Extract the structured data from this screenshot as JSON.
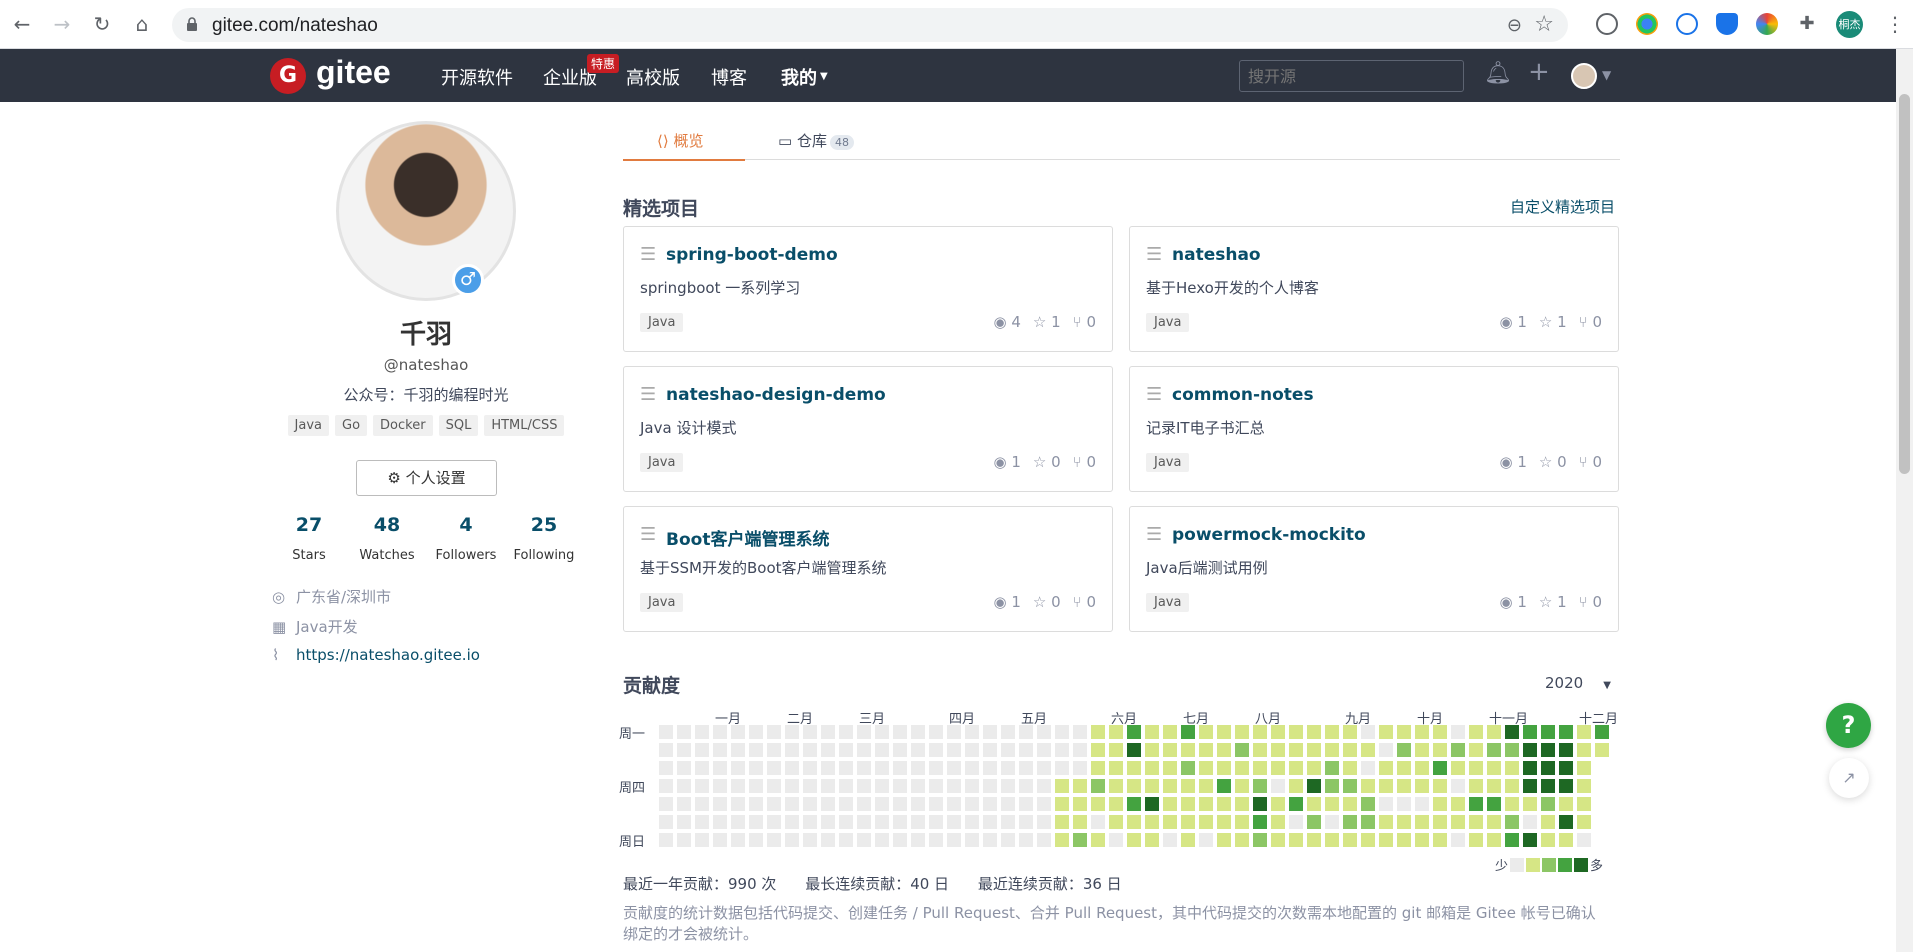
{
  "browser": {
    "url": "gitee.com/nateshao",
    "profile_badge": "桐杰"
  },
  "topnav": {
    "logo": "gitee",
    "links": [
      "开源软件",
      "企业版",
      "高校版",
      "博客",
      "我的"
    ],
    "hot_badge": "特惠",
    "search_placeholder": "搜开源"
  },
  "profile": {
    "name": "千羽",
    "handle": "@nateshao",
    "bio": "公众号：千羽的编程时光",
    "skills": [
      "Java",
      "Go",
      "Docker",
      "SQL",
      "HTML/CSS"
    ],
    "settings_label": "个人设置",
    "stats": [
      {
        "num": "27",
        "label": "Stars"
      },
      {
        "num": "48",
        "label": "Watches"
      },
      {
        "num": "4",
        "label": "Followers"
      },
      {
        "num": "25",
        "label": "Following"
      }
    ],
    "location": "广东省/深圳市",
    "job": "Java开发",
    "website": "https://nateshao.gitee.io"
  },
  "tabs": {
    "overview": "概览",
    "repos": "仓库",
    "repos_count": "48"
  },
  "featured": {
    "title": "精选项目",
    "customize_link": "自定义精选项目",
    "projects": [
      {
        "name": "spring-boot-demo",
        "desc": "springboot 一系列学习",
        "lang": "Java",
        "watch": "4",
        "star": "1",
        "fork": "0"
      },
      {
        "name": "nateshao",
        "desc": "基于Hexo开发的个人博客",
        "lang": "Java",
        "watch": "1",
        "star": "1",
        "fork": "0"
      },
      {
        "name": "nateshao-design-demo",
        "desc": "Java 设计模式",
        "lang": "Java",
        "watch": "1",
        "star": "0",
        "fork": "0"
      },
      {
        "name": "common-notes",
        "desc": "记录IT电子书汇总",
        "lang": "Java",
        "watch": "1",
        "star": "0",
        "fork": "0"
      },
      {
        "name": "Boot客户端管理系统",
        "desc": "基于SSM开发的Boot客户端管理系统",
        "lang": "Java",
        "watch": "1",
        "star": "0",
        "fork": "0"
      },
      {
        "name": "powermock-mockito",
        "desc": "Java后端测试用例",
        "lang": "Java",
        "watch": "1",
        "star": "1",
        "fork": "0"
      }
    ]
  },
  "contributions": {
    "title": "贡献度",
    "year": "2020",
    "months": [
      "一月",
      "二月",
      "三月",
      "四月",
      "五月",
      "六月",
      "七月",
      "八月",
      "九月",
      "十月",
      "十一月",
      "十二月"
    ],
    "day_labels": [
      "周一",
      "周四",
      "周日"
    ],
    "legend_less": "少",
    "legend_more": "多",
    "summary_year": "最近一年贡献：990 次",
    "summary_longest": "最长连续贡献：40 日",
    "summary_recent": "最近连续贡献：36 日",
    "note": "贡献度的统计数据包括代码提交、创建任务 / Pull Request、合并 Pull Request，其中代码提交的次数需本地配置的 git 邮箱是 Gitee 帐号已确认绑定的才会被统计。",
    "colors": [
      "#ebebeb",
      "#d6e685",
      "#8cc665",
      "#44a340",
      "#1e6823"
    ]
  },
  "colors": {
    "nav_bg": "#2e3440",
    "brand_red": "#c71d23",
    "link": "#094e69",
    "tab_active": "#e17b3f",
    "help_green": "#2fa644"
  }
}
